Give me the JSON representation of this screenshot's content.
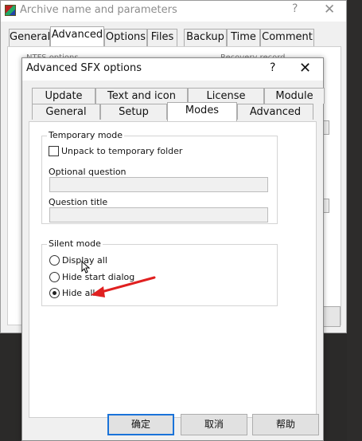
{
  "parent_window": {
    "title": "Archive name and parameters",
    "help_label": "?",
    "close_label": "✕",
    "tabs": [
      {
        "label": "General"
      },
      {
        "label": "Advanced"
      },
      {
        "label": "Options"
      },
      {
        "label": "Files"
      },
      {
        "label": "Backup"
      },
      {
        "label": "Time"
      },
      {
        "label": "Comment"
      }
    ],
    "active_tab": "Advanced",
    "partial_left": "NTFS options",
    "partial_right": "Recovery record"
  },
  "dialog": {
    "title": "Advanced SFX options",
    "help_label": "?",
    "close_label": "✕",
    "tabs_top": [
      {
        "label": "Update"
      },
      {
        "label": "Text and icon"
      },
      {
        "label": "License"
      },
      {
        "label": "Module"
      }
    ],
    "tabs_bottom": [
      {
        "label": "General"
      },
      {
        "label": "Setup"
      },
      {
        "label": "Modes"
      },
      {
        "label": "Advanced"
      }
    ],
    "active_tab": "Modes",
    "temporary_mode": {
      "title": "Temporary mode",
      "unpack_label": "Unpack to temporary folder",
      "unpack_checked": false,
      "optional_question_label": "Optional question",
      "optional_question_value": "",
      "question_title_label": "Question title",
      "question_title_value": ""
    },
    "silent_mode": {
      "title": "Silent mode",
      "options": [
        {
          "label": "Display all",
          "checked": false
        },
        {
          "label": "Hide start dialog",
          "checked": false
        },
        {
          "label": "Hide all",
          "checked": true
        }
      ]
    },
    "buttons": {
      "ok": "确定",
      "cancel": "取消",
      "help": "帮助"
    }
  },
  "colors": {
    "annotation_arrow": "#e02020",
    "default_button_border": "#1a73d9"
  }
}
